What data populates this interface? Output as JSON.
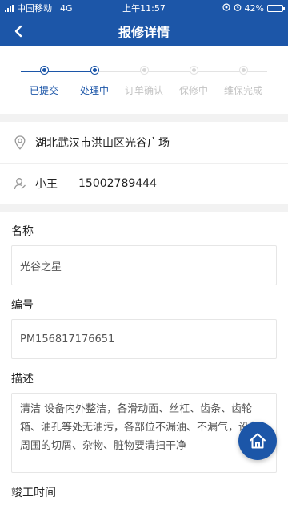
{
  "status_bar": {
    "carrier": "中国移动",
    "network": "4G",
    "time": "上午11:57",
    "battery": "42%",
    "battery_level": 0.42
  },
  "nav": {
    "title": "报修详情",
    "back_icon": "chevron-left-icon"
  },
  "steps": [
    {
      "label": "已提交",
      "state": "done"
    },
    {
      "label": "处理中",
      "state": "active"
    },
    {
      "label": "订单确认",
      "state": "pending"
    },
    {
      "label": "保修中",
      "state": "pending"
    },
    {
      "label": "维保完成",
      "state": "pending"
    }
  ],
  "contact": {
    "address": "湖北武汉市洪山区光谷广场",
    "name": "小王",
    "phone": "15002789444"
  },
  "form": {
    "name_label": "名称",
    "name_value": "光谷之星",
    "number_label": "编号",
    "number_value": "PM156817176651",
    "desc_label": "描述",
    "desc_value": "清洁 设备内外整洁，各滑动面、丝杠、齿条、齿轮箱、油孔等处无油污，各部位不漏油、不漏气，设备周围的切屑、杂物、脏物要清扫干净",
    "completion_label": "竣工时间"
  },
  "colors": {
    "primary": "#1c56a8",
    "inactive": "#c4c4c4",
    "background": "#f2f2f2"
  }
}
